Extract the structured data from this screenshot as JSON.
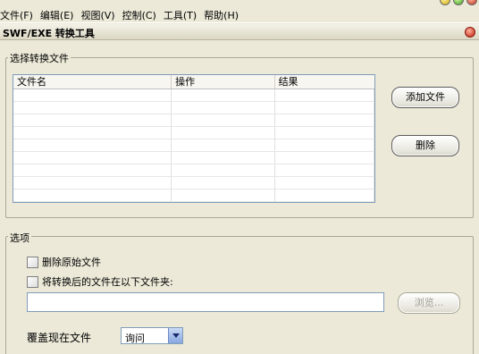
{
  "menu": [
    "文件(F)",
    "编辑(E)",
    "视图(V)",
    "控制(C)",
    "工具(T)",
    "帮助(H)"
  ],
  "window": {
    "title": "SWF/EXE 转换工具"
  },
  "file_group": {
    "label": "选择转换文件",
    "columns": [
      "文件名",
      "操作",
      "结果"
    ],
    "add_button": "添加文件",
    "delete_button": "删除"
  },
  "options_group": {
    "label": "选项",
    "delete_original_label": "删除原始文件",
    "delete_original_checked": false,
    "save_to_folder_label": "将转换后的文件在以下文件夹:",
    "save_to_folder_checked": false,
    "folder_path": "",
    "browse_button": "浏览...",
    "overwrite_label": "覆盖现在文件",
    "overwrite_value": "询问"
  }
}
